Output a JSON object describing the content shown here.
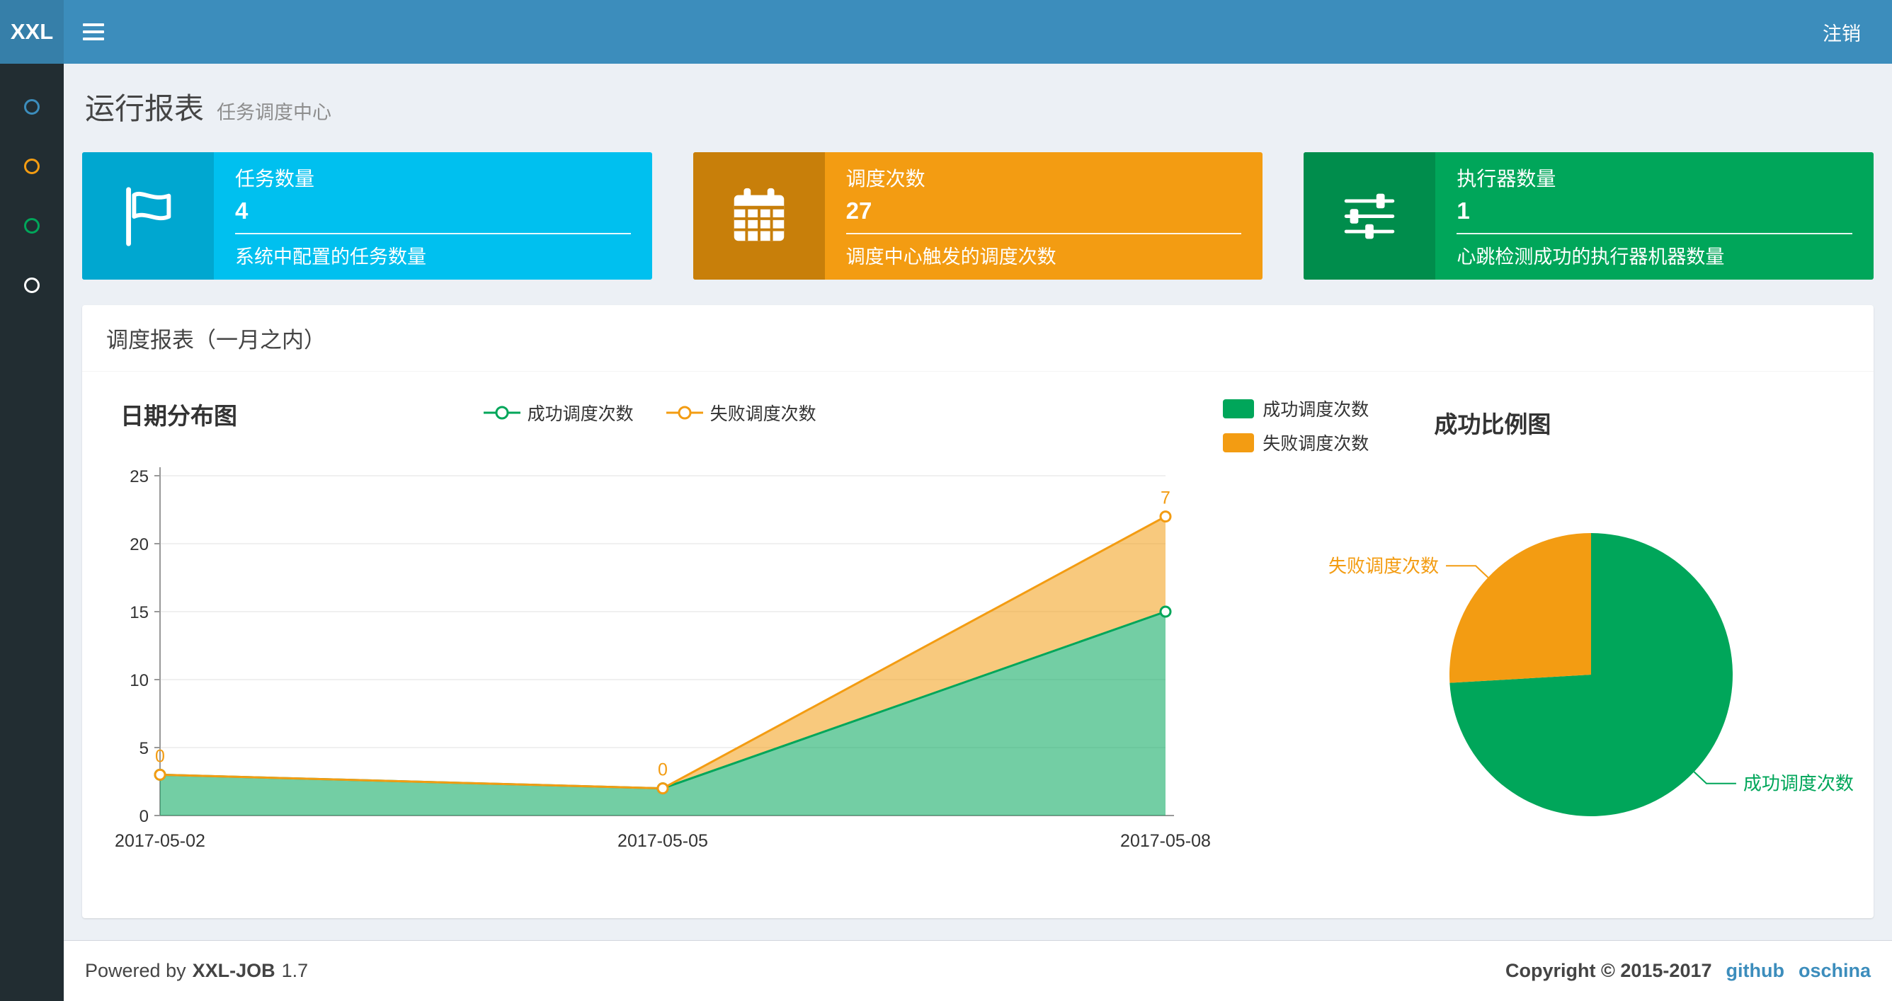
{
  "navbar": {
    "logo": "XXL",
    "logout_label": "注销",
    "bg_color": "#3c8dbc",
    "logo_bg_color": "#367fa9"
  },
  "sidebar": {
    "bg_color": "#222d32",
    "items": [
      {
        "icon": "circle-icon",
        "color": "#3c8dbc"
      },
      {
        "icon": "circle-icon",
        "color": "#f39c12"
      },
      {
        "icon": "circle-icon",
        "color": "#00a65a"
      },
      {
        "icon": "circle-icon",
        "color": "#ffffff"
      }
    ]
  },
  "header": {
    "title": "运行报表",
    "subtitle": "任务调度中心"
  },
  "info_boxes": [
    {
      "icon": "flag-icon",
      "label": "任务数量",
      "value": "4",
      "desc": "系统中配置的任务数量",
      "color": "#00c0ef",
      "icon_bg": "#00a7d0"
    },
    {
      "icon": "calendar-icon",
      "label": "调度次数",
      "value": "27",
      "desc": "调度中心触发的调度次数",
      "color": "#f39c12",
      "icon_bg": "#c87f0a"
    },
    {
      "icon": "sliders-icon",
      "label": "执行器数量",
      "value": "1",
      "desc": "心跳检测成功的执行器机器数量",
      "color": "#00a65a",
      "icon_bg": "#008d4c"
    }
  ],
  "panel": {
    "title": "调度报表（一月之内）"
  },
  "chart_data": [
    {
      "type": "area",
      "title": "日期分布图",
      "x": [
        "2017-05-02",
        "2017-05-05",
        "2017-05-08"
      ],
      "stacked": true,
      "series": [
        {
          "name": "成功调度次数",
          "color": "#00a65a",
          "values": [
            3,
            2,
            15
          ]
        },
        {
          "name": "失败调度次数",
          "color": "#f39c12",
          "values": [
            0,
            0,
            7
          ]
        }
      ],
      "ylim": [
        0,
        25
      ],
      "yticks": [
        0,
        5,
        10,
        15,
        20,
        25
      ],
      "grid": true,
      "legend_position": "top-center",
      "point_labels": {
        "series": "失败调度次数",
        "values": [
          "0",
          "0",
          "7"
        ]
      }
    },
    {
      "type": "pie",
      "title": "成功比例图",
      "legend_position": "top-left",
      "start_angle": "top",
      "direction": "clockwise",
      "slices": [
        {
          "name": "成功调度次数",
          "value": 20,
          "color": "#00a65a"
        },
        {
          "name": "失败调度次数",
          "value": 7,
          "color": "#f39c12"
        }
      ]
    }
  ],
  "footer": {
    "powered_prefix": "Powered by",
    "brand": "XXL-JOB",
    "version": "1.7",
    "copyright": "Copyright © 2015-2017",
    "links": [
      {
        "label": "github"
      },
      {
        "label": "oschina"
      }
    ]
  }
}
